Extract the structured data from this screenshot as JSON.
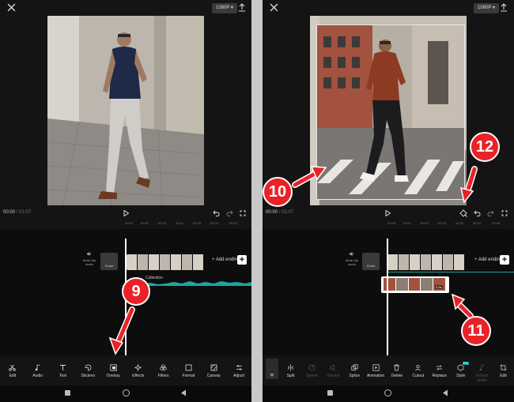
{
  "left": {
    "resolution": "1080P",
    "time_current": "00:00",
    "time_total": "01:07",
    "ruler_ticks": [
      "00:00",
      "00:01",
      "00:02",
      "00:02",
      "00:03",
      "00:04",
      "00:05"
    ],
    "mute_label": "Mute clip audio",
    "cover_label": "Cover",
    "add_ending_label": "+ Add ending",
    "audio_track_label": "Collection",
    "step_badge": "9",
    "toolbar": [
      {
        "label": "Edit",
        "icon": "scissors-icon"
      },
      {
        "label": "Audio",
        "icon": "music-note-icon"
      },
      {
        "label": "Text",
        "icon": "text-icon"
      },
      {
        "label": "Stickers",
        "icon": "sticker-icon"
      },
      {
        "label": "Overlay",
        "icon": "overlay-icon"
      },
      {
        "label": "Effects",
        "icon": "sparkle-icon"
      },
      {
        "label": "Filters",
        "icon": "filters-icon"
      },
      {
        "label": "Format",
        "icon": "format-icon"
      },
      {
        "label": "Canvas",
        "icon": "canvas-icon"
      },
      {
        "label": "Adjust",
        "icon": "sliders-icon"
      }
    ]
  },
  "right": {
    "resolution": "1080P",
    "time_current": "00:00",
    "time_total": "01:07",
    "ruler_ticks": [
      "00:00",
      "00:01",
      "00:02",
      "00:02",
      "00:03",
      "00:04",
      "00:05"
    ],
    "mute_label": "Mute clip audio",
    "cover_label": "Cover",
    "add_ending_label": "+ Add ending",
    "overlay_clip_time": "3.9s",
    "badges": [
      "10",
      "11",
      "12"
    ],
    "toolbar": [
      {
        "label": "Split",
        "icon": "split-icon",
        "enabled": true
      },
      {
        "label": "Speed",
        "icon": "speed-icon",
        "enabled": false
      },
      {
        "label": "Volume",
        "icon": "volume-icon",
        "enabled": false
      },
      {
        "label": "Splice",
        "icon": "splice-icon",
        "enabled": true
      },
      {
        "label": "Animation",
        "icon": "animation-icon",
        "enabled": true
      },
      {
        "label": "Delete",
        "icon": "trash-icon",
        "enabled": true
      },
      {
        "label": "Cutout",
        "icon": "cutout-icon",
        "enabled": true
      },
      {
        "label": "Replace",
        "icon": "replace-icon",
        "enabled": true
      },
      {
        "label": "Style",
        "icon": "style-icon",
        "enabled": true,
        "badge": "Pro"
      },
      {
        "label": "Extract audio",
        "icon": "extract-audio-icon",
        "enabled": false
      },
      {
        "label": "Edit",
        "icon": "crop-icon",
        "enabled": true
      }
    ]
  },
  "colors": {
    "accent_red": "#ea2227",
    "waveform_teal": "#17a9a0",
    "background": "#141414"
  }
}
